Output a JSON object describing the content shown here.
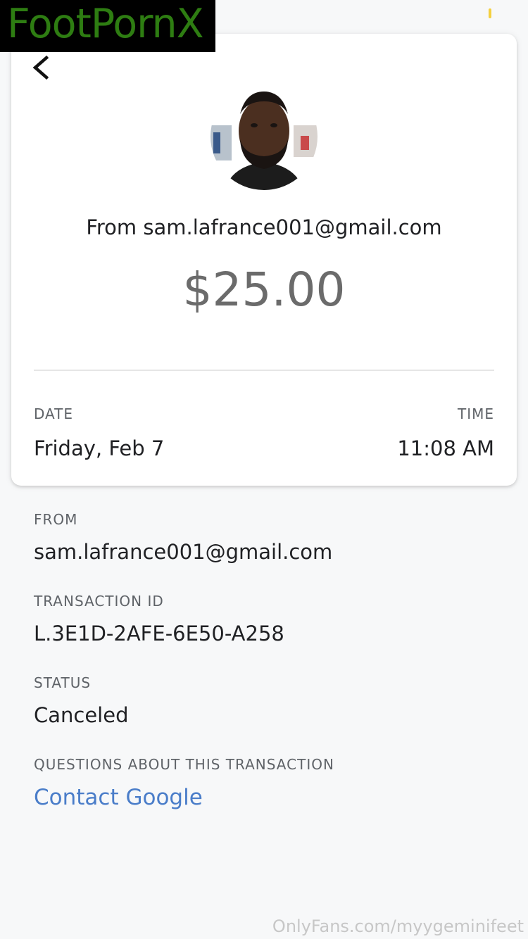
{
  "watermark": {
    "top_text": "FootPornX",
    "bottom_text": "OnlyFans.com/myygeminifeet"
  },
  "card": {
    "from_heading": "From sam.lafrance001@gmail.com",
    "amount": "$25.00",
    "date_label": "DATE",
    "date_value": "Friday, Feb 7",
    "time_label": "TIME",
    "time_value": "11:08 AM"
  },
  "details": {
    "from_label": "FROM",
    "from_value": "sam.lafrance001@gmail.com",
    "transaction_id_label": "TRANSACTION ID",
    "transaction_id_value": "L.3E1D-2AFE-6E50-A258",
    "status_label": "STATUS",
    "status_value": "Canceled",
    "questions_label": "QUESTIONS ABOUT THIS TRANSACTION",
    "contact_link": "Contact Google"
  },
  "icons": {
    "back": "chevron-left-icon",
    "avatar": "avatar"
  },
  "colors": {
    "link": "#4a7dc9",
    "amount": "#6b6b6b",
    "status_indicator": "#f4d03f",
    "watermark_text": "#2e7d12"
  }
}
